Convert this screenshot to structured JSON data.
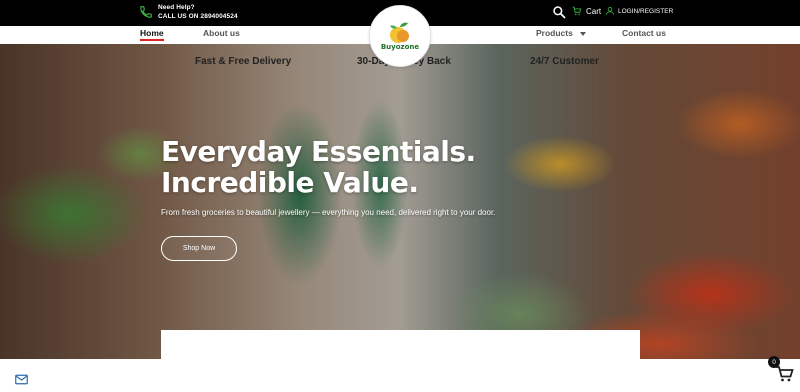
{
  "topbar": {
    "help_title": "Need Help?",
    "help_phone": "CALL US ON 2894004524",
    "cart_label": "Cart",
    "login_label": "LOGIN/REGISTER"
  },
  "nav": {
    "home": "Home",
    "about": "About us",
    "products": "Products",
    "contact": "Contact us"
  },
  "logo": {
    "text": "Buyozone"
  },
  "hero": {
    "title_line1": "Everyday Essentials.",
    "title_line2": "Incredible Value.",
    "subtitle": "From fresh groceries to beautiful jewellery — everything you need, delivered right to your door.",
    "button": "Shop Now"
  },
  "features": {
    "items": [
      "Fast & Free Delivery",
      "30-Day Money Back",
      "24/7 Customer"
    ]
  },
  "floating_cart": {
    "count": "0"
  },
  "icons": [
    "phone-icon",
    "search-icon",
    "cart-icon",
    "user-icon",
    "logo-fruit-icon",
    "mail-icon",
    "floating-cart-icon"
  ],
  "colors": {
    "accent": "#e02424",
    "topbar_bg": "#000000",
    "phone_icon": "#3cb043",
    "logo_green": "#1f6f2a"
  }
}
